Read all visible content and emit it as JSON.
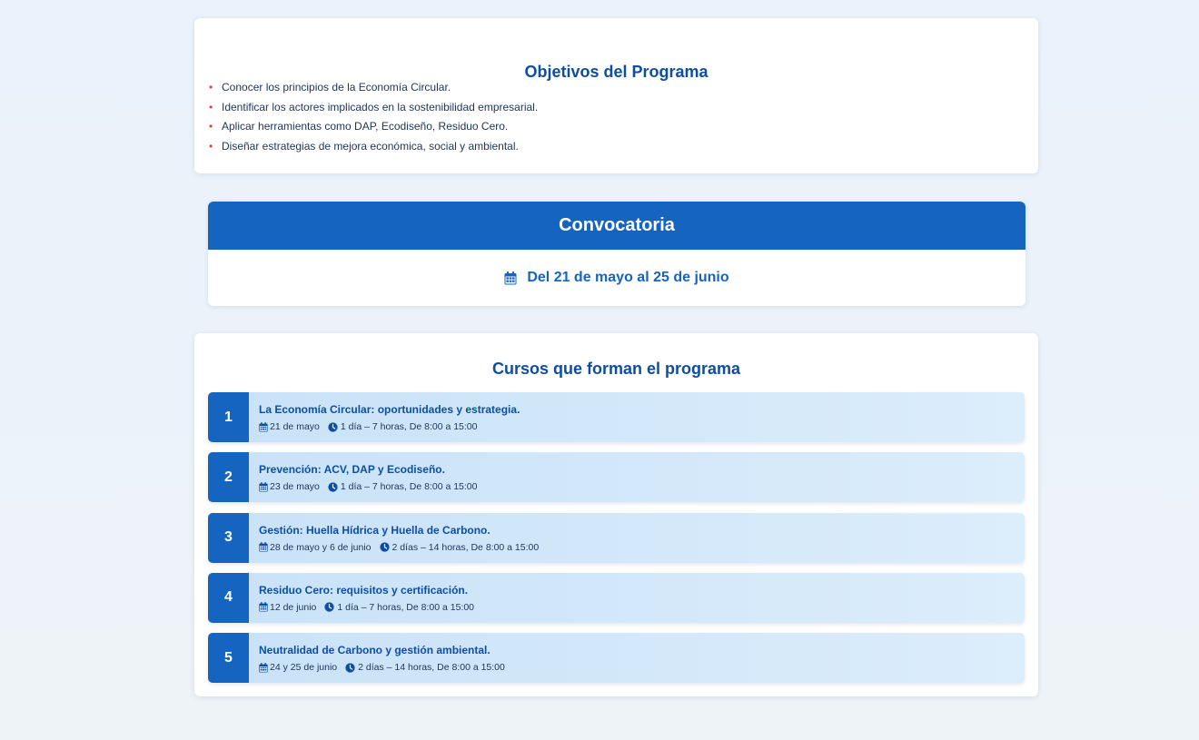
{
  "objectives": {
    "title": "Objetivos del Programa",
    "items": [
      "Conocer los principios de la Economía Circular.",
      "Identificar los actores implicados en la sostenibilidad empresarial.",
      "Aplicar herramientas como DAP, Ecodiseño, Residuo Cero.",
      "Diseñar estrategias de mejora económica, social y ambiental."
    ],
    "bullet": "•"
  },
  "convocatoria": {
    "title": "Convocatoria",
    "dates": "Del 21 de mayo al 25 de junio",
    "icon": "calendar-icon"
  },
  "courses": {
    "title": "Cursos que forman el programa",
    "items": [
      {
        "number": "1",
        "title": "La Economía Circular: oportunidades y estrategia.",
        "date": "21 de mayo",
        "schedule": "1 día – 7 horas, De 8:00 a 15:00"
      },
      {
        "number": "2",
        "title": "Prevención: ACV, DAP y Ecodiseño.",
        "date": "23 de mayo",
        "schedule": "1 día – 7 horas, De 8:00 a 15:00"
      },
      {
        "number": "3",
        "title": "Gestión: Huella Hídrica y Huella de Carbono.",
        "date": "28 de mayo y 6 de junio",
        "schedule": "2 días – 14 horas, De 8:00 a 15:00"
      },
      {
        "number": "4",
        "title": "Residuo Cero: requisitos y certificación.",
        "date": "12 de junio",
        "schedule": "1 día – 7 horas, De 8:00 a 15:00"
      },
      {
        "number": "5",
        "title": "Neutralidad de Carbono y gestión ambiental.",
        "date": "24 y 25 de junio",
        "schedule": "2 días – 14 horas, De 8:00 a 15:00"
      }
    ]
  },
  "colors": {
    "primary": "#1565c0",
    "heading": "#0d4ea3",
    "bullet": "#e0413b",
    "course_bg": "#c9e2f8"
  }
}
